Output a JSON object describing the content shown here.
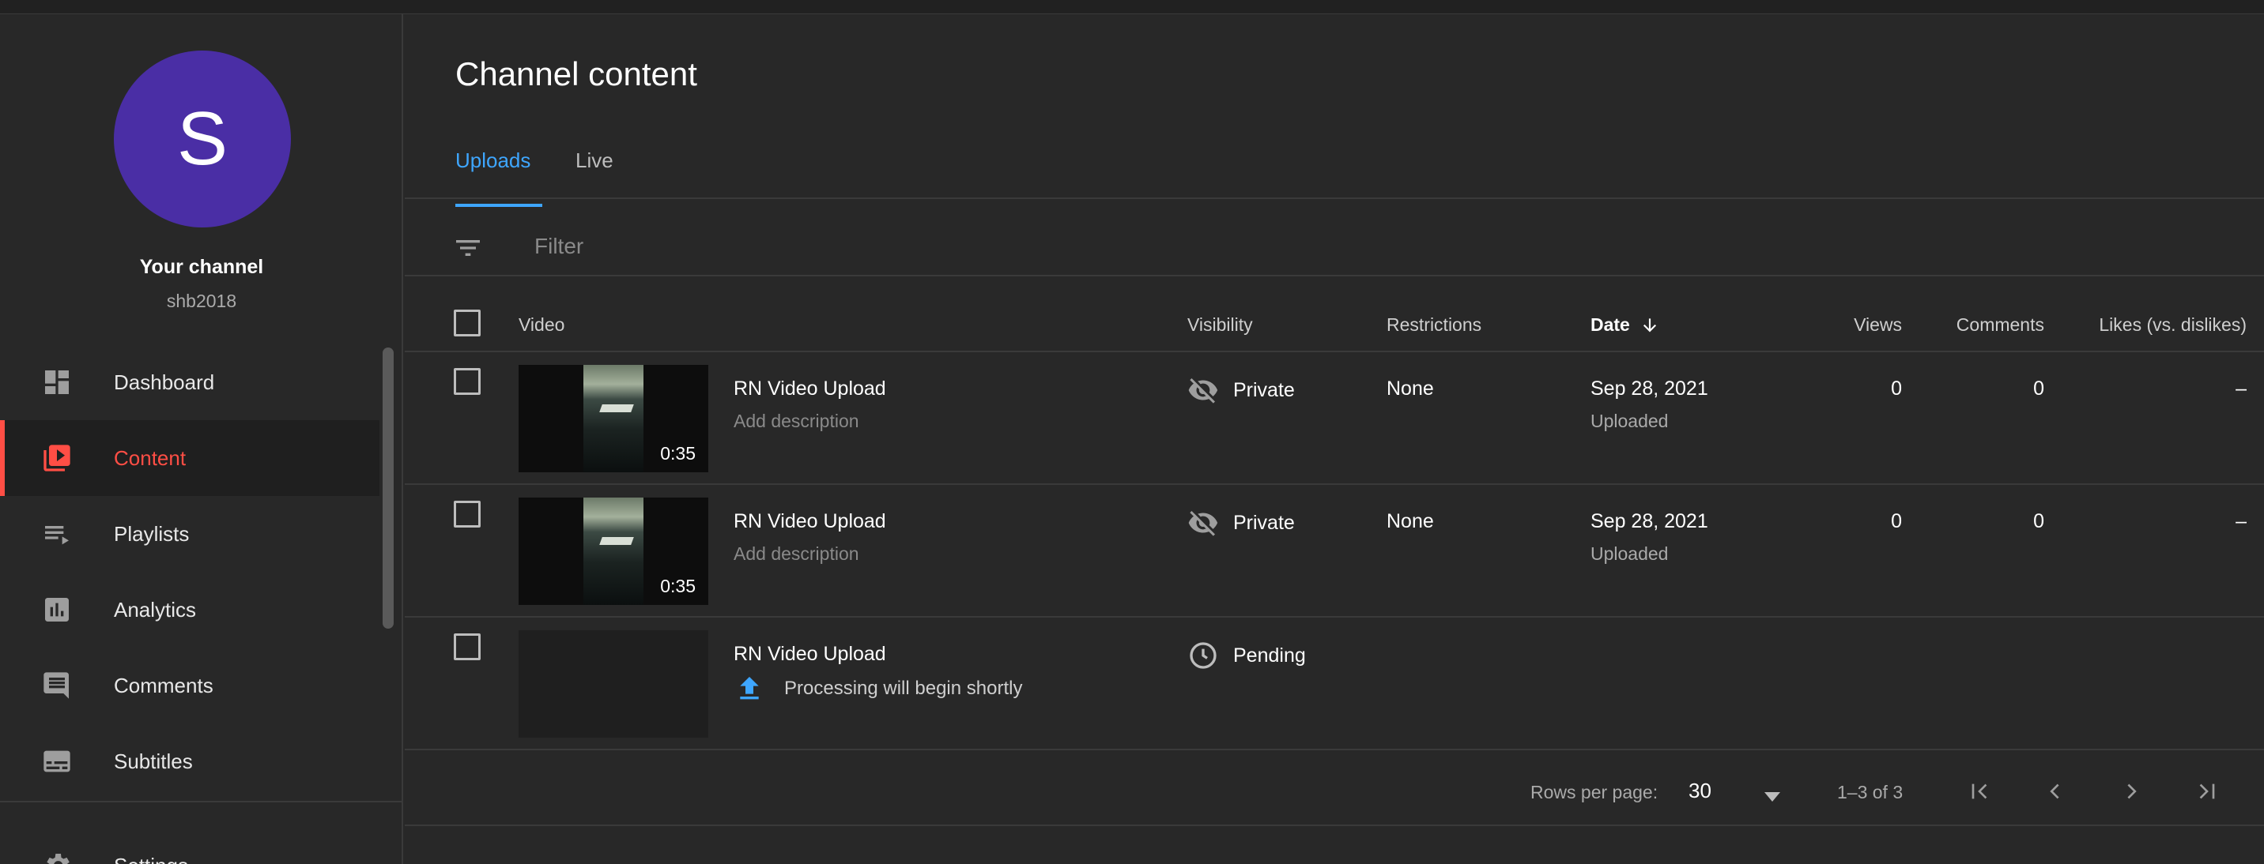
{
  "sidebar": {
    "avatar_letter": "S",
    "channel_title": "Your channel",
    "channel_handle": "shb2018",
    "items": [
      {
        "label": "Dashboard",
        "icon": "dashboard-icon"
      },
      {
        "label": "Content",
        "icon": "content-icon",
        "active": true
      },
      {
        "label": "Playlists",
        "icon": "playlists-icon"
      },
      {
        "label": "Analytics",
        "icon": "analytics-icon"
      },
      {
        "label": "Comments",
        "icon": "comments-icon"
      },
      {
        "label": "Subtitles",
        "icon": "subtitles-icon"
      }
    ],
    "settings_label": "Settings"
  },
  "main": {
    "title": "Channel content",
    "tabs": [
      {
        "label": "Uploads",
        "active": true
      },
      {
        "label": "Live"
      }
    ],
    "filter_placeholder": "Filter",
    "columns": {
      "video": "Video",
      "visibility": "Visibility",
      "restrictions": "Restrictions",
      "date": "Date",
      "views": "Views",
      "comments": "Comments",
      "likes": "Likes (vs. dislikes)"
    },
    "rows": [
      {
        "title": "RN Video Upload",
        "description": "Add description",
        "duration": "0:35",
        "visibility": "Private",
        "restrictions": "None",
        "date": "Sep 28, 2021",
        "date_status": "Uploaded",
        "views": "0",
        "comments": "0",
        "likes": "–"
      },
      {
        "title": "RN Video Upload",
        "description": "Add description",
        "duration": "0:35",
        "visibility": "Private",
        "restrictions": "None",
        "date": "Sep 28, 2021",
        "date_status": "Uploaded",
        "views": "0",
        "comments": "0",
        "likes": "–"
      },
      {
        "title": "RN Video Upload",
        "processing_status": "Processing will begin shortly",
        "visibility": "Pending"
      }
    ],
    "footer": {
      "rows_per_page_label": "Rows per page:",
      "rows_per_page_value": "30",
      "range": "1–3 of 3"
    }
  },
  "colors": {
    "accent_blue": "#3ea6ff",
    "active_red": "#ff4e45",
    "avatar": "#4a2ea5",
    "background": "#282828"
  }
}
